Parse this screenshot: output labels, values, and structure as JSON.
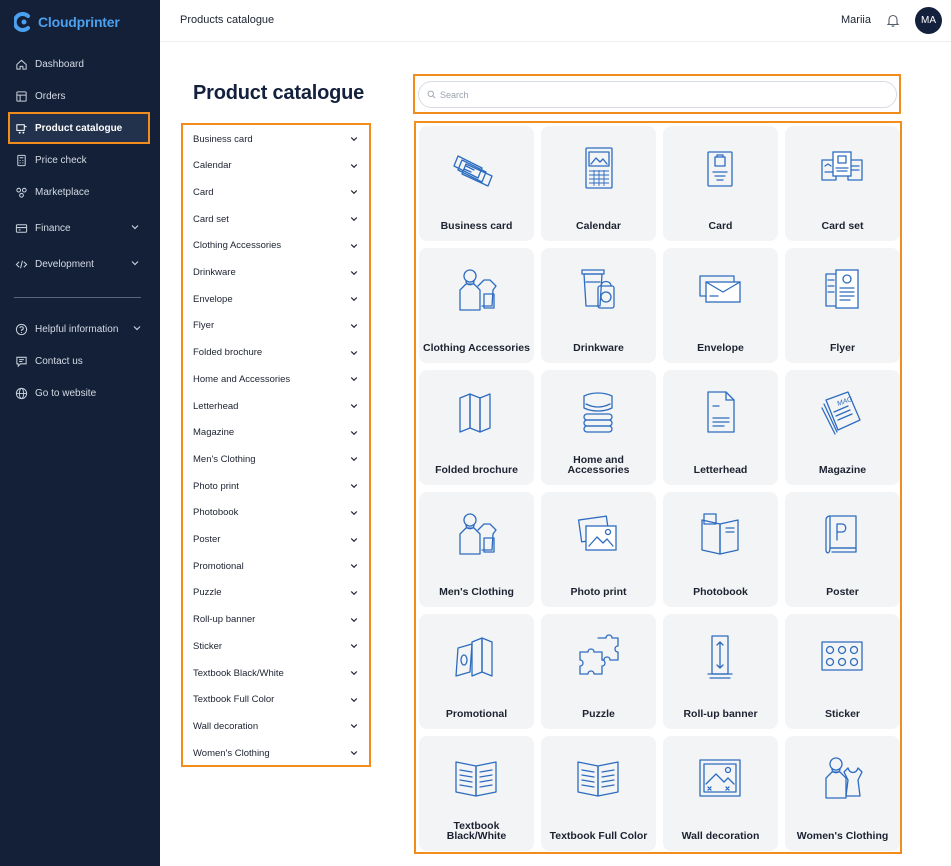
{
  "app": {
    "brand": "Cloudprinter",
    "accent": "#f28c1a",
    "sidebar_bg": "#132037",
    "icon_color": "#2d6cc0"
  },
  "sidebar": {
    "items": [
      {
        "label": "Dashboard",
        "icon": "home-icon"
      },
      {
        "label": "Orders",
        "icon": "orders-icon"
      },
      {
        "label": "Product catalogue",
        "icon": "catalogue-icon",
        "active": true
      },
      {
        "label": "Price check",
        "icon": "calculator-icon"
      },
      {
        "label": "Marketplace",
        "icon": "marketplace-icon"
      },
      {
        "label": "Finance",
        "icon": "finance-icon",
        "expandable": true
      },
      {
        "label": "Development",
        "icon": "code-icon",
        "expandable": true
      }
    ],
    "bottom_items": [
      {
        "label": "Helpful information",
        "icon": "help-icon",
        "expandable": true
      },
      {
        "label": "Contact us",
        "icon": "chat-icon"
      },
      {
        "label": "Go to website",
        "icon": "globe-icon"
      }
    ]
  },
  "header": {
    "breadcrumb": "Products catalogue",
    "user_name": "Mariia",
    "avatar_initials": "MA"
  },
  "main": {
    "title": "Product catalogue"
  },
  "search": {
    "placeholder": "Search",
    "value": ""
  },
  "categories": [
    "Business card",
    "Calendar",
    "Card",
    "Card set",
    "Clothing Accessories",
    "Drinkware",
    "Envelope",
    "Flyer",
    "Folded brochure",
    "Home and Accessories",
    "Letterhead",
    "Magazine",
    "Men's Clothing",
    "Photo print",
    "Photobook",
    "Poster",
    "Promotional",
    "Puzzle",
    "Roll-up banner",
    "Sticker",
    "Textbook Black/White",
    "Textbook Full Color",
    "Wall decoration",
    "Women's Clothing"
  ],
  "products": [
    {
      "label": "Business card",
      "icon": "business-card-icon"
    },
    {
      "label": "Calendar",
      "icon": "calendar-icon"
    },
    {
      "label": "Card",
      "icon": "card-icon"
    },
    {
      "label": "Card set",
      "icon": "card-set-icon"
    },
    {
      "label": "Clothing Accessories",
      "icon": "clothing-accessories-icon"
    },
    {
      "label": "Drinkware",
      "icon": "drinkware-icon"
    },
    {
      "label": "Envelope",
      "icon": "envelope-icon"
    },
    {
      "label": "Flyer",
      "icon": "flyer-icon"
    },
    {
      "label": "Folded brochure",
      "icon": "folded-brochure-icon"
    },
    {
      "label": "Home and Accessories",
      "icon": "home-accessories-icon"
    },
    {
      "label": "Letterhead",
      "icon": "letterhead-icon"
    },
    {
      "label": "Magazine",
      "icon": "magazine-icon"
    },
    {
      "label": "Men's Clothing",
      "icon": "mens-clothing-icon"
    },
    {
      "label": "Photo print",
      "icon": "photo-print-icon"
    },
    {
      "label": "Photobook",
      "icon": "photobook-icon"
    },
    {
      "label": "Poster",
      "icon": "poster-icon"
    },
    {
      "label": "Promotional",
      "icon": "promotional-icon"
    },
    {
      "label": "Puzzle",
      "icon": "puzzle-icon"
    },
    {
      "label": "Roll-up banner",
      "icon": "rollup-banner-icon"
    },
    {
      "label": "Sticker",
      "icon": "sticker-icon"
    },
    {
      "label": "Textbook Black/White",
      "icon": "textbook-bw-icon"
    },
    {
      "label": "Textbook Full Color",
      "icon": "textbook-color-icon"
    },
    {
      "label": "Wall decoration",
      "icon": "wall-decoration-icon"
    },
    {
      "label": "Women's Clothing",
      "icon": "womens-clothing-icon"
    }
  ]
}
